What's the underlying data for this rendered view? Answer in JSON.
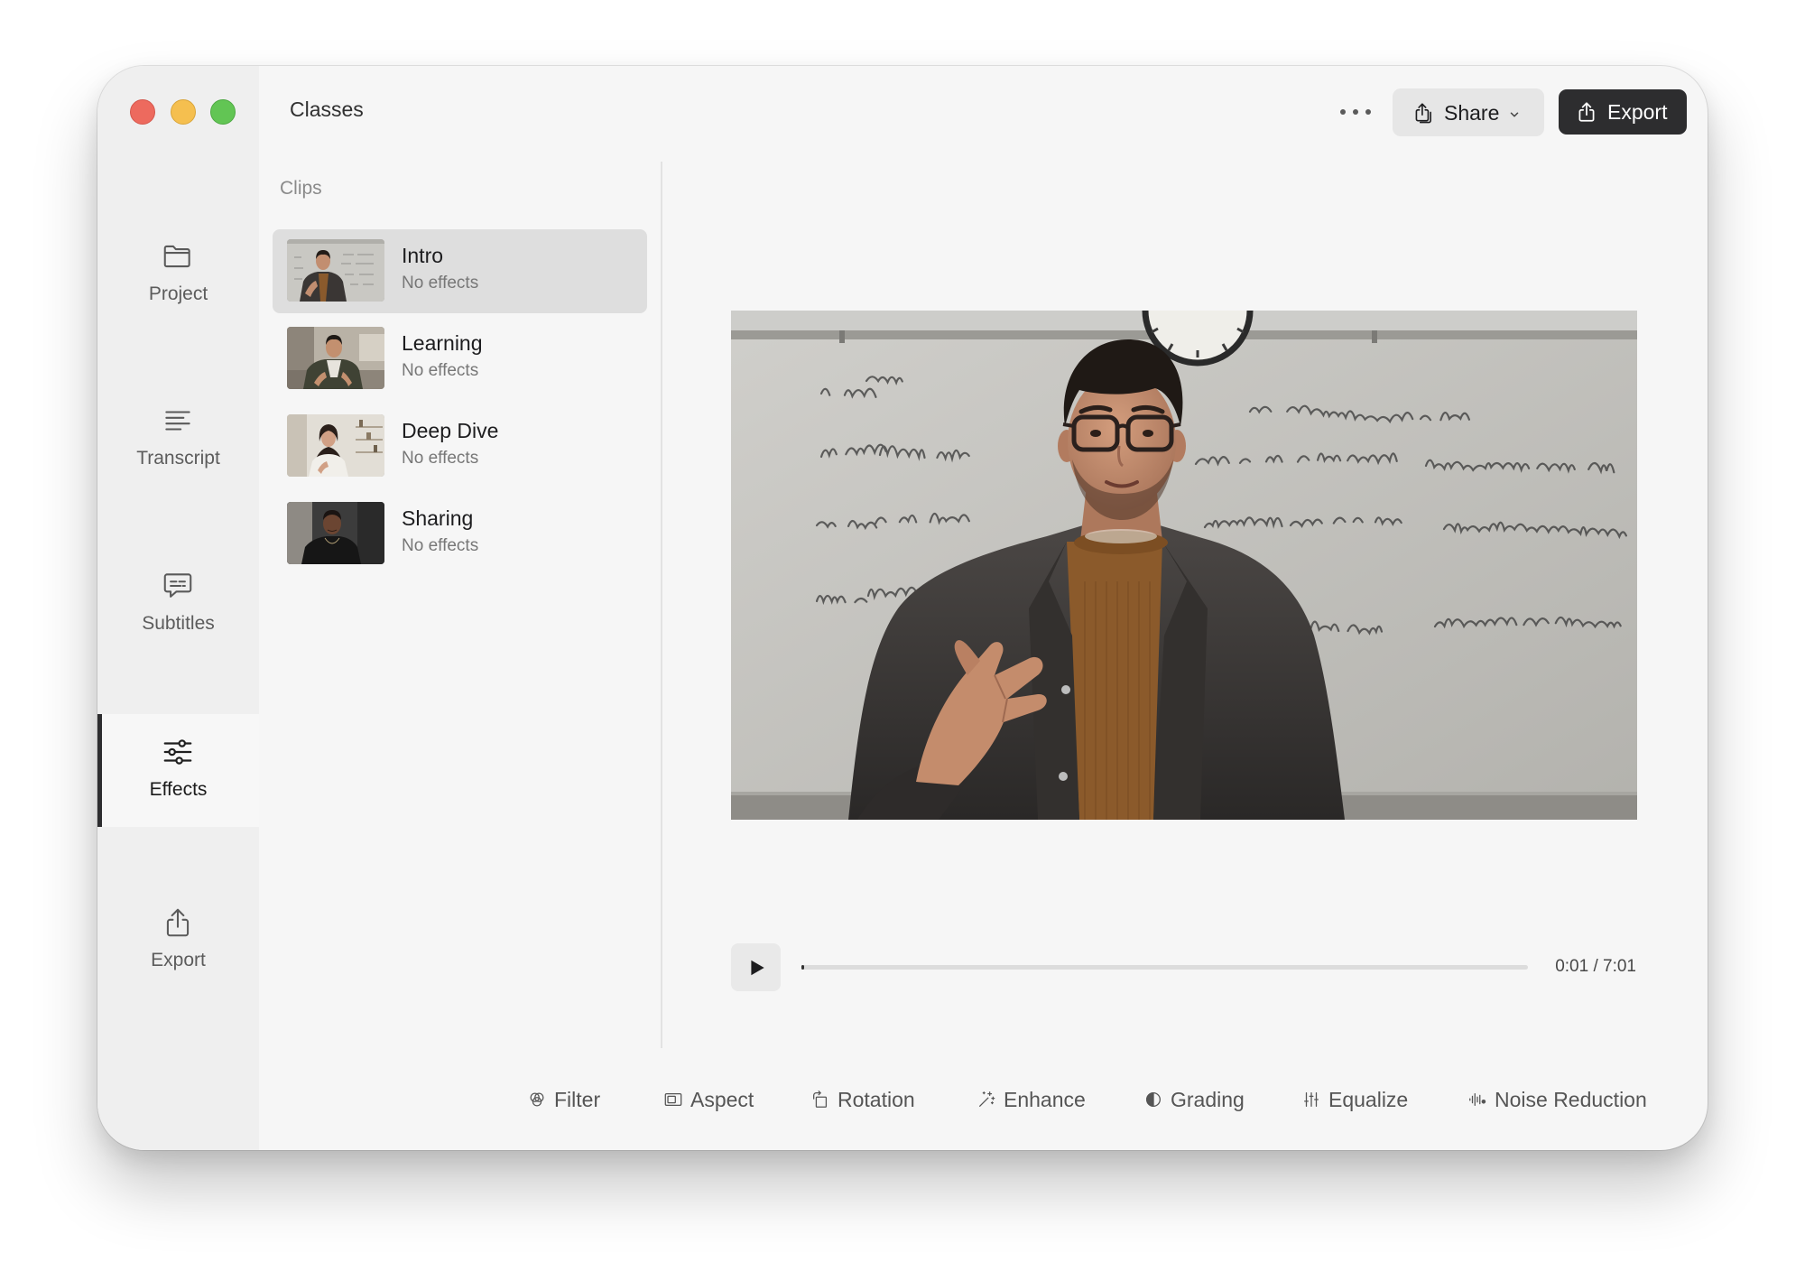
{
  "app": {
    "title": "Classes"
  },
  "window_controls": {
    "close": {
      "icon": "close-window-icon",
      "color": "#ed6a5e"
    },
    "minimize": {
      "icon": "minimize-window-icon",
      "color": "#f5bf4f"
    },
    "zoom": {
      "icon": "zoom-window-icon",
      "color": "#62c554"
    }
  },
  "header": {
    "more": {
      "icon": "ellipsis-icon"
    },
    "share": {
      "label": "Share",
      "icon": "share-icon",
      "menu_icon": "chevron-down-icon"
    },
    "export": {
      "label": "Export",
      "icon": "export-icon"
    }
  },
  "sidebar": {
    "items": [
      {
        "label": "Project",
        "icon": "folder-icon",
        "selected": false
      },
      {
        "label": "Transcript",
        "icon": "transcript-icon",
        "selected": false
      },
      {
        "label": "Subtitles",
        "icon": "subtitles-icon",
        "selected": false
      },
      {
        "label": "Effects",
        "icon": "sliders-icon",
        "selected": true
      },
      {
        "label": "Export",
        "icon": "export-icon",
        "selected": false
      }
    ]
  },
  "clips": {
    "heading": "Clips",
    "items": [
      {
        "title": "Intro",
        "status": "No effects",
        "selected": true
      },
      {
        "title": "Learning",
        "status": "No effects",
        "selected": false
      },
      {
        "title": "Deep Dive",
        "status": "No effects",
        "selected": false
      },
      {
        "title": "Sharing",
        "status": "No effects",
        "selected": false
      }
    ]
  },
  "player": {
    "play_icon": "play-icon",
    "time": "0:01 / 7:01",
    "progress": 0.0024
  },
  "toolbar": {
    "items": [
      {
        "label": "Filter",
        "icon": "filter-icon"
      },
      {
        "label": "Aspect",
        "icon": "aspect-ratio-icon"
      },
      {
        "label": "Rotation",
        "icon": "rotation-icon"
      },
      {
        "label": "Enhance",
        "icon": "magic-wand-icon"
      },
      {
        "label": "Grading",
        "icon": "color-grading-icon"
      },
      {
        "label": "Equalize",
        "icon": "equalizer-icon"
      },
      {
        "label": "Noise Reduction",
        "icon": "waveform-icon"
      }
    ]
  },
  "colors": {
    "window_bg": "#f6f6f6",
    "sidebar_bg": "#efefef",
    "selected_clip_bg": "#dedede",
    "accent_dark": "#2d2d2f"
  }
}
